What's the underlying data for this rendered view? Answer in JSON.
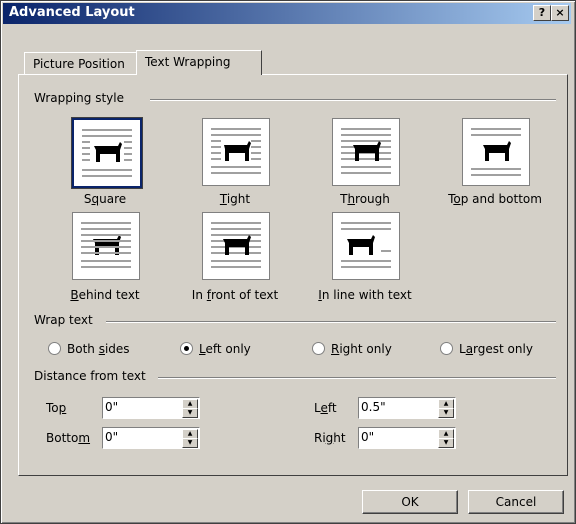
{
  "window": {
    "title": "Advanced Layout",
    "help_label": "?",
    "close_label": "×"
  },
  "tabs": [
    {
      "label": "Picture Position",
      "active": false
    },
    {
      "label": "Text Wrapping",
      "active": true
    }
  ],
  "wrapping_style": {
    "label": "Wrapping style",
    "options": [
      {
        "label_pre": "S",
        "label_u": "q",
        "label_post": "uare",
        "icon": "square-wrap-icon",
        "selected": true
      },
      {
        "label_pre": "",
        "label_u": "T",
        "label_post": "ight",
        "icon": "tight-wrap-icon",
        "selected": false
      },
      {
        "label_pre": "T",
        "label_u": "h",
        "label_post": "rough",
        "icon": "through-wrap-icon",
        "selected": false
      },
      {
        "label_pre": "T",
        "label_u": "o",
        "label_post": "p and bottom",
        "icon": "top-bottom-wrap-icon",
        "selected": false
      },
      {
        "label_pre": "",
        "label_u": "B",
        "label_post": "ehind text",
        "icon": "behind-text-icon",
        "selected": false
      },
      {
        "label_pre": "In ",
        "label_u": "f",
        "label_post": "ront of text",
        "icon": "in-front-text-icon",
        "selected": false
      },
      {
        "label_pre": "",
        "label_u": "I",
        "label_post": "n line with text",
        "icon": "inline-text-icon",
        "selected": false
      }
    ]
  },
  "wrap_text": {
    "label": "Wrap text",
    "options": [
      {
        "label_pre": "Both ",
        "label_u": "s",
        "label_post": "ides",
        "checked": false
      },
      {
        "label_pre": "",
        "label_u": "L",
        "label_post": "eft only",
        "checked": true
      },
      {
        "label_pre": "",
        "label_u": "R",
        "label_post": "ight only",
        "checked": false
      },
      {
        "label_pre": "L",
        "label_u": "a",
        "label_post": "rgest only",
        "checked": false
      }
    ]
  },
  "distance": {
    "label": "Distance from text",
    "top": {
      "label_pre": "To",
      "label_u": "p",
      "label_post": "",
      "value": "0\""
    },
    "bottom": {
      "label_pre": "Botto",
      "label_u": "m",
      "label_post": "",
      "value": "0\""
    },
    "left": {
      "label_pre": "L",
      "label_u": "e",
      "label_post": "ft",
      "value": "0.5\""
    },
    "right": {
      "label_pre": "Ri",
      "label_u": "g",
      "label_post": "ht",
      "value": "0\""
    }
  },
  "buttons": {
    "ok": "OK",
    "cancel": "Cancel"
  },
  "colors": {
    "title_bar": "#0a246a",
    "dialog_bg": "#d4d0c8",
    "selected_border": "#0a246a"
  }
}
